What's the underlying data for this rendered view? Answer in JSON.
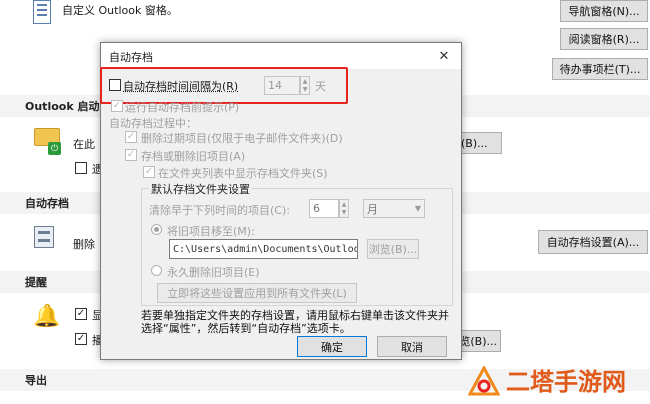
{
  "background": {
    "top_description": "自定义 Outlook 窗格。",
    "buttons": {
      "nav_pane": "导航窗格(N)...",
      "reading_pane": "阅读窗格(R)...",
      "todo_bar": "待办事项栏(T)...",
      "archive_settings": "自动存档设置(A)...",
      "partial_b": "(B)...",
      "browse_partial": "浏览(B)..."
    },
    "sections": {
      "outlook_start": "Outlook 启动",
      "autoarchive": "自动存档",
      "reminders": "提醒",
      "export": "导出"
    },
    "partial_texts": {
      "start_in": "在此",
      "start_check": "遗",
      "archive_delete": "删除",
      "reminder_1": "显",
      "reminder_2": "播"
    }
  },
  "dialog": {
    "title": "自动存档",
    "run_every_label": "自动存档时间间隔为(R)",
    "run_every_value": "14",
    "run_every_unit": "天",
    "prompt_label": "运行自动存档前提示(P)",
    "during_label": "自动存档过程中：",
    "delete_expired": "删除过期项目(仅限于电子邮件文件夹)(D)",
    "archive_old": "存档或删除旧项目(A)",
    "show_folder": "在文件夹列表中显示存档文件夹(S)",
    "defaults_heading": "默认存档文件夹设置",
    "clean_older_label": "清除早于下列时间的项目(C):",
    "clean_older_value": "6",
    "clean_older_unit": "月",
    "move_old_label": "将旧项目移至(M):",
    "move_path": "C:\\Users\\admin\\Documents\\Outloo",
    "browse_label": "浏览(B)...",
    "perm_delete_label": "永久删除旧项目(E)",
    "apply_all_label": "立即将这些设置应用到所有文件夹(L)",
    "info_text": "若要单独指定文件夹的存档设置，请用鼠标右键单击该文件夹并选择“属性”，然后转到“自动存档”选项卡。",
    "ok_label": "确定",
    "cancel_label": "取消",
    "close_glyph": "✕",
    "highlight_color": "#e8231f"
  },
  "watermark": {
    "text": "二塔手游网"
  }
}
